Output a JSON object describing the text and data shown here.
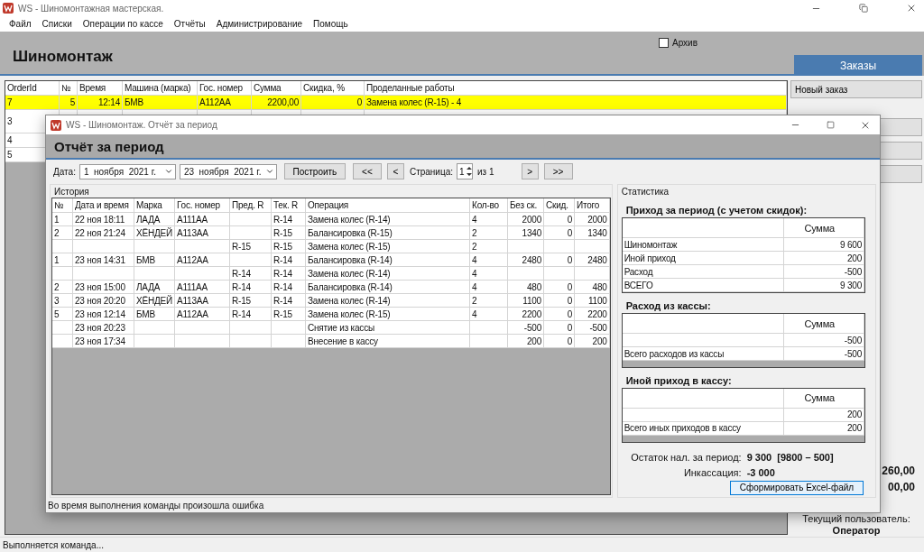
{
  "window": {
    "title": "WS - Шиномонтажная мастерская."
  },
  "menu": [
    "Файл",
    "Списки",
    "Операции по кассе",
    "Отчёты",
    "Администрирование",
    "Помощь"
  ],
  "header": {
    "title": "Шиномонтаж",
    "archive": {
      "label": "Архив",
      "checked": false
    }
  },
  "orders_table": {
    "columns": [
      "OrderId",
      "№",
      "Время",
      "Машина (марка)",
      "Гос. номер",
      "Сумма",
      "Скидка, %",
      "Проделанные работы"
    ],
    "rows": [
      {
        "selected": true,
        "cells": [
          "7",
          "5",
          "12:14",
          "БМВ",
          "А112АА",
          "2200,00",
          "0",
          "Замена колес (R-15) - 4"
        ]
      },
      {
        "selected": false,
        "cells": [
          "3"
        ]
      },
      {
        "selected": false,
        "cells": [
          "4"
        ]
      },
      {
        "selected": false,
        "cells": [
          "5"
        ]
      }
    ]
  },
  "side_panel": {
    "tab": "Заказы",
    "new_order_button": "Новый заказ",
    "totals": [
      "260,00",
      "00,00"
    ],
    "user_label": "Текущий пользователь:",
    "user": "Оператор"
  },
  "status_bar": "Выполняется команда...",
  "dialog": {
    "title": "WS - Шиномонтаж. Отчёт за период",
    "heading": "Отчёт за период",
    "toolbar": {
      "date_label": "Дата:",
      "date_from": "1  ноября  2021 г.",
      "date_to": "23  ноября  2021 г.",
      "build_button": "Построить",
      "first_button": "<<",
      "prev_button": "<",
      "page_label": "Страница:",
      "page": "1",
      "page_total": "из 1",
      "next_button": ">",
      "last_button": ">>"
    },
    "history": {
      "title": "История",
      "columns": [
        "№",
        "Дата и время",
        "Марка",
        "Гос. номер",
        "Пред. R",
        "Тек. R",
        "Операция",
        "Кол-во",
        "Без ск.",
        "Скид.",
        "Итого"
      ],
      "rows": [
        [
          "1",
          "22 ноя 18:11",
          "ЛАДА",
          "А111АА",
          null,
          "R-14",
          "Замена колес (R-14)",
          "4",
          "2000",
          "0",
          "2000"
        ],
        [
          "2",
          "22 ноя 21:24",
          "ХЁНДЕЙ",
          "А113АА",
          null,
          "R-15",
          "Балансировка (R-15)",
          "2",
          "1340",
          "0",
          "1340"
        ],
        [
          null,
          null,
          null,
          null,
          "R-15",
          "R-15",
          "Замена колес (R-15)",
          "2",
          null,
          null,
          null
        ],
        [
          "1",
          "23 ноя 14:31",
          "БМВ",
          "А112АА",
          null,
          "R-14",
          "Балансировка (R-14)",
          "4",
          "2480",
          "0",
          "2480"
        ],
        [
          null,
          null,
          null,
          null,
          "R-14",
          "R-14",
          "Замена колес (R-14)",
          "4",
          null,
          null,
          null
        ],
        [
          "2",
          "23 ноя 15:00",
          "ЛАДА",
          "А111АА",
          "R-14",
          "R-14",
          "Балансировка (R-14)",
          "4",
          "480",
          "0",
          "480"
        ],
        [
          "3",
          "23 ноя 20:20",
          "ХЁНДЕЙ",
          "А113АА",
          "R-15",
          "R-14",
          "Замена колес (R-14)",
          "2",
          "1100",
          "0",
          "1100"
        ],
        [
          "5",
          "23 ноя 12:14",
          "БМВ",
          "А112АА",
          "R-14",
          "R-15",
          "Замена колес (R-15)",
          "4",
          "2200",
          "0",
          "2200"
        ],
        [
          null,
          "23 ноя 20:23",
          null,
          null,
          null,
          null,
          "Снятие из кассы",
          null,
          "-500",
          "0",
          "-500"
        ],
        [
          null,
          "23 ноя 17:34",
          null,
          null,
          null,
          null,
          "Внесение в кассу",
          null,
          "200",
          "0",
          "200"
        ]
      ]
    },
    "stats": {
      "title": "Статистика",
      "tables": [
        {
          "title": "Приход за период (с учетом скидок):",
          "column": "Сумма",
          "rows": [
            {
              "label": "Шиномонтаж",
              "value": "9 600"
            },
            {
              "label": "Иной приход",
              "value": "200"
            },
            {
              "label": "Расход",
              "value": "-500"
            },
            {
              "label": "ВСЕГО",
              "value": "9 300"
            }
          ]
        },
        {
          "title": "Расход из кассы:",
          "column": "Сумма",
          "rows": [
            {
              "value": "-500"
            },
            {
              "label": "Всего расходов из кассы",
              "value": "-500"
            }
          ]
        },
        {
          "title": "Иной приход в кассу:",
          "column": "Сумма",
          "rows": [
            {
              "value": "200"
            },
            {
              "label": "Всего иных приходов в кассу",
              "value": "200"
            }
          ]
        }
      ],
      "balance_label": "Остаток нал. за период:",
      "balance": "9 300  [9800 – 500]",
      "collection_label": "Инкассация:",
      "collection": "-3 000",
      "export_button": "Сформировать Excel-файл"
    },
    "status": "Во время выполнения команды произошла ошибка"
  }
}
